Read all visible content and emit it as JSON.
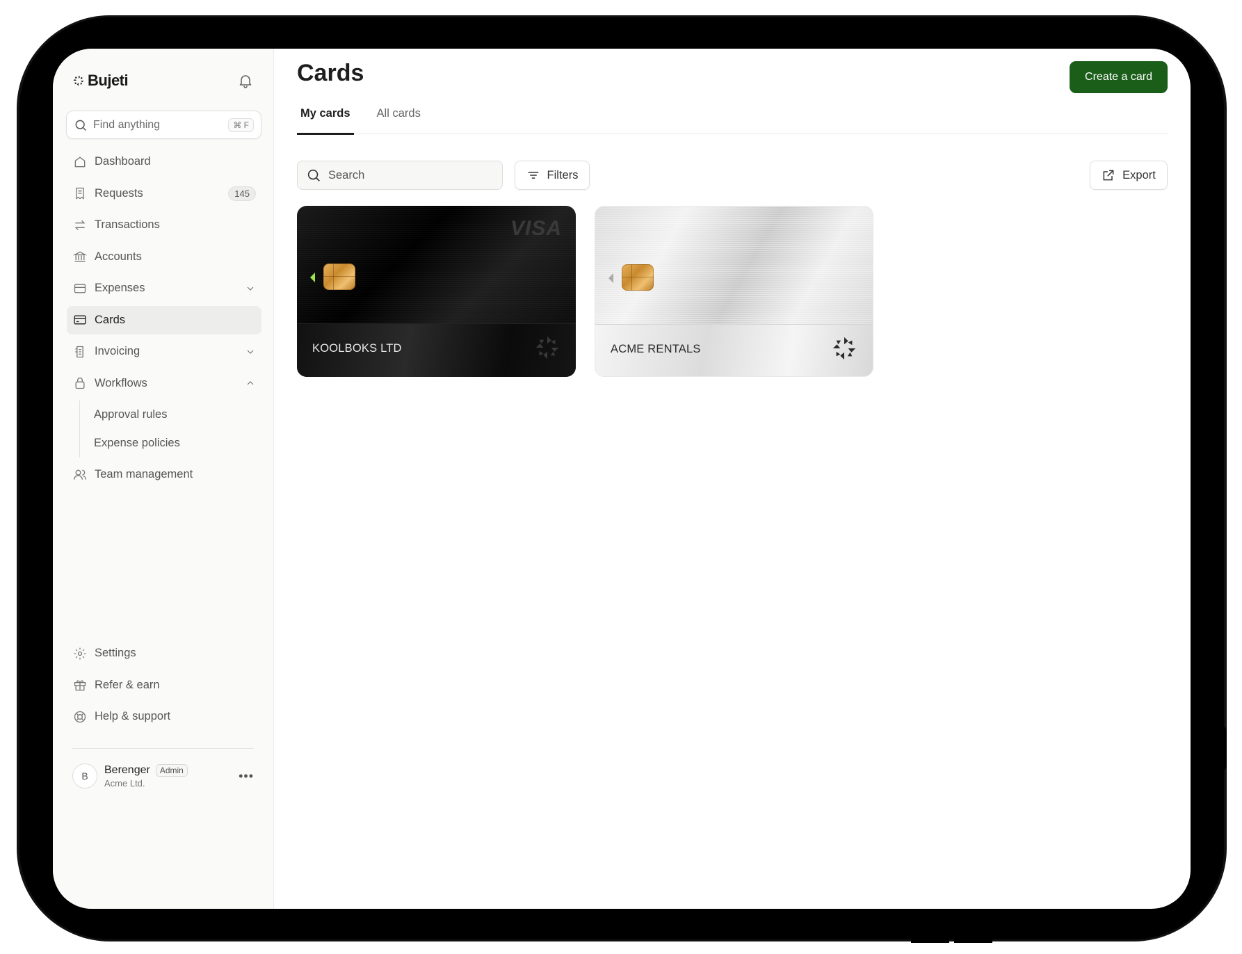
{
  "brand": {
    "name": "Bujeti"
  },
  "sidebar": {
    "search": {
      "placeholder": "Find anything",
      "shortcut": "⌘ F"
    },
    "items": [
      {
        "label": "Dashboard",
        "icon": "home-icon"
      },
      {
        "label": "Requests",
        "icon": "receipt-icon",
        "badge": "145"
      },
      {
        "label": "Transactions",
        "icon": "arrows-swap-icon"
      },
      {
        "label": "Accounts",
        "icon": "bank-icon"
      },
      {
        "label": "Expenses",
        "icon": "wallet-icon",
        "expandable": true
      },
      {
        "label": "Cards",
        "icon": "card-icon",
        "active": true
      },
      {
        "label": "Invoicing",
        "icon": "invoice-icon",
        "expandable": true
      },
      {
        "label": "Workflows",
        "icon": "lock-icon",
        "expanded": true
      }
    ],
    "workflow_sub_items": [
      {
        "label": "Approval rules"
      },
      {
        "label": "Expense policies"
      }
    ],
    "team": {
      "label": "Team management",
      "icon": "users-icon"
    },
    "bottom_items": [
      {
        "label": "Settings",
        "icon": "gear-icon"
      },
      {
        "label": "Refer & earn",
        "icon": "gift-icon"
      },
      {
        "label": "Help & support",
        "icon": "lifebuoy-icon"
      }
    ],
    "user": {
      "initial": "B",
      "name": "Berenger",
      "role": "Admin",
      "org": "Acme Ltd."
    }
  },
  "main": {
    "title": "Cards",
    "create_button": "Create a card",
    "tabs": [
      {
        "label": "My cards",
        "active": true
      },
      {
        "label": "All cards",
        "active": false
      }
    ],
    "search_placeholder": "Search",
    "filters_label": "Filters",
    "export_label": "Export",
    "cards": [
      {
        "holder": "KOOLBOKS LTD",
        "network": "VISA",
        "style": "dark"
      },
      {
        "holder": "ACME RENTALS",
        "network": "",
        "style": "light"
      }
    ]
  },
  "colors": {
    "primary": "#1a5e1a",
    "sidebar_bg": "#fafaf9",
    "active_bg": "#ededeb"
  }
}
